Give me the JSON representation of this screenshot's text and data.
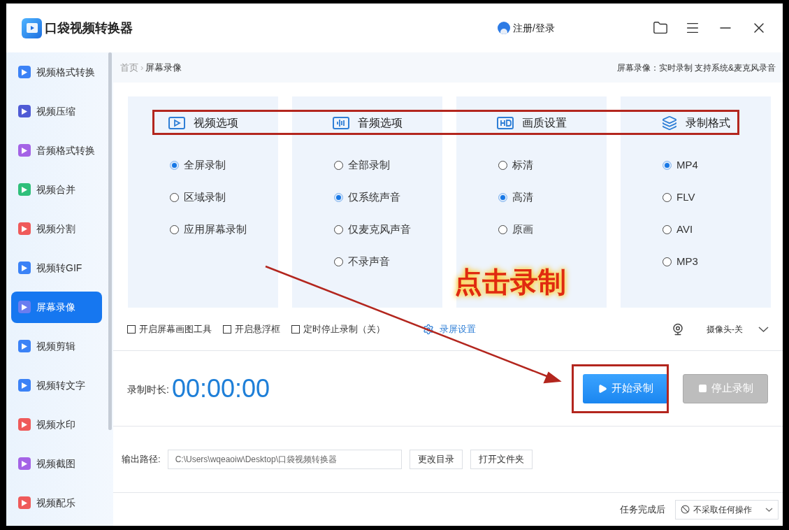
{
  "app": {
    "title": "口袋视频转换器",
    "user_label": "注册/登录"
  },
  "sidebar": {
    "items": [
      {
        "label": "视频格式转换",
        "selected": false,
        "color": "#3b82f6"
      },
      {
        "label": "视频压缩",
        "selected": false,
        "color": "#4f5bd5"
      },
      {
        "label": "音频格式转换",
        "selected": false,
        "color": "#a463e6"
      },
      {
        "label": "视频合并",
        "selected": false,
        "color": "#2fbf7a"
      },
      {
        "label": "视频分割",
        "selected": false,
        "color": "#ef5a5a"
      },
      {
        "label": "视频转GIF",
        "selected": false,
        "color": "#3b82f6"
      },
      {
        "label": "屏幕录像",
        "selected": true,
        "color": "#6a7df0"
      },
      {
        "label": "视频剪辑",
        "selected": false,
        "color": "#3b82f6"
      },
      {
        "label": "视频转文字",
        "selected": false,
        "color": "#3b82f6"
      },
      {
        "label": "视频水印",
        "selected": false,
        "color": "#ef5a5a"
      },
      {
        "label": "视频截图",
        "selected": false,
        "color": "#a463e6"
      },
      {
        "label": "视频配乐",
        "selected": false,
        "color": "#ef5a5a"
      }
    ]
  },
  "breadcrumb": {
    "home": "首页",
    "separator": "›",
    "current": "屏幕录像",
    "description": "屏幕录像：实时录制 支持系统&麦克风录音"
  },
  "option_groups": [
    {
      "title": "视频选项",
      "kind": "video",
      "options": [
        {
          "label": "全屏录制",
          "selected": true
        },
        {
          "label": "区域录制",
          "selected": false
        },
        {
          "label": "应用屏幕录制",
          "selected": false
        }
      ]
    },
    {
      "title": "音频选项",
      "kind": "audio",
      "options": [
        {
          "label": "全部录制",
          "selected": false
        },
        {
          "label": "仅系统声音",
          "selected": true
        },
        {
          "label": "仅麦克风声音",
          "selected": false
        },
        {
          "label": "不录声音",
          "selected": false
        }
      ]
    },
    {
      "title": "画质设置",
      "kind": "hd",
      "options": [
        {
          "label": "标清",
          "selected": false
        },
        {
          "label": "高清",
          "selected": true
        },
        {
          "label": "原画",
          "selected": false
        }
      ]
    },
    {
      "title": "录制格式",
      "kind": "layers",
      "options": [
        {
          "label": "MP4",
          "selected": true
        },
        {
          "label": "FLV",
          "selected": false
        },
        {
          "label": "AVI",
          "selected": false
        },
        {
          "label": "MP3",
          "selected": false
        }
      ]
    }
  ],
  "toggles": [
    {
      "label": "开启屏幕画图工具",
      "checked": false
    },
    {
      "label": "开启悬浮框",
      "checked": false
    },
    {
      "label": "定时停止录制（关）",
      "checked": false
    }
  ],
  "settings_link": "录屏设置",
  "camera": {
    "label": "摄像头-关"
  },
  "timer": {
    "label": "录制时长:",
    "value": "00:00:00"
  },
  "record_buttons": [
    {
      "label": "开始录制",
      "kind": "start",
      "disabled": false
    },
    {
      "label": "停止录制",
      "kind": "stop",
      "disabled": true
    }
  ],
  "output": {
    "label": "输出路径:",
    "path": "C:\\Users\\wqeaoiw\\Desktop\\口袋视频转换器",
    "buttons": [
      "更改目录",
      "打开文件夹"
    ]
  },
  "footer": {
    "label": "任务完成后",
    "select_value": "不采取任何操作"
  },
  "annotation": {
    "callout": "点击录制"
  }
}
